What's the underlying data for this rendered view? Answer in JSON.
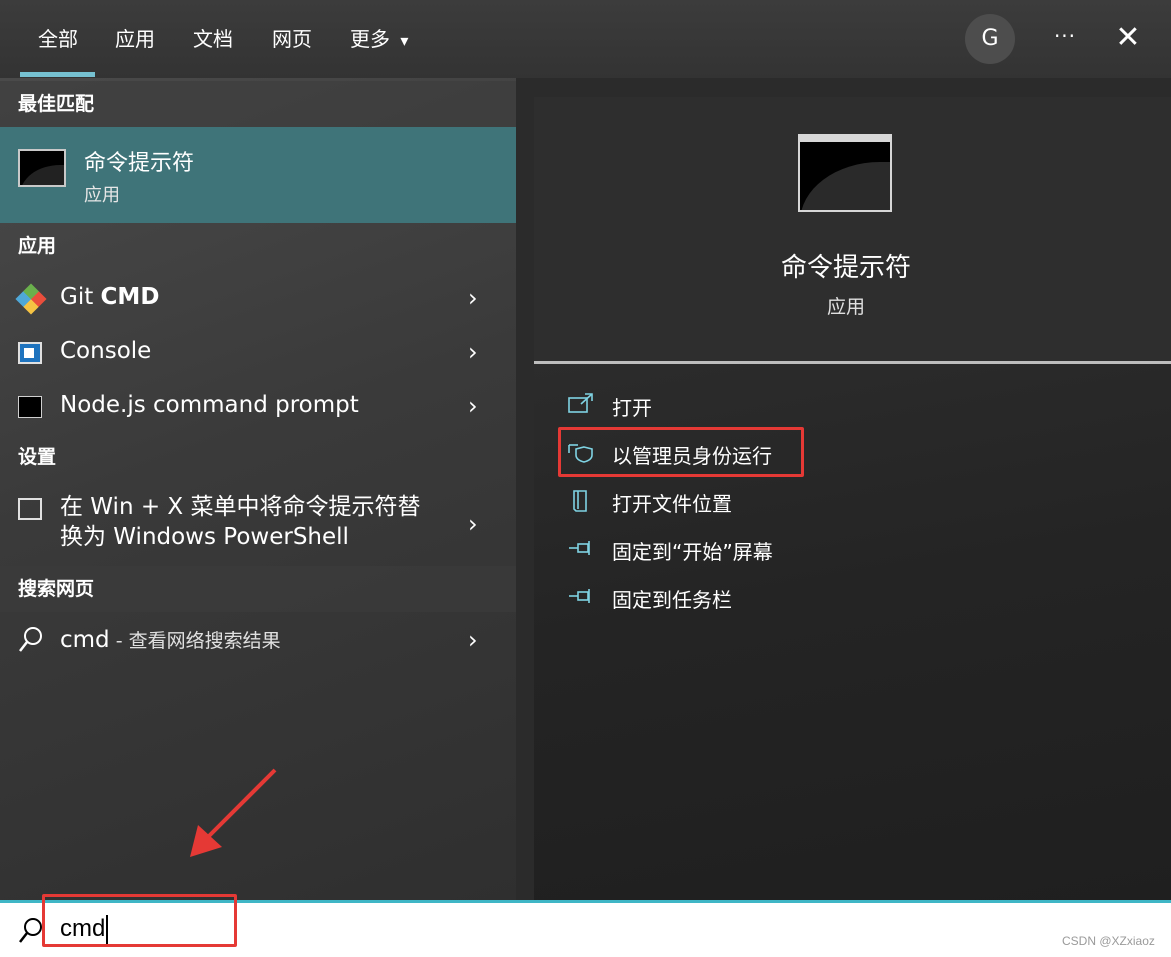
{
  "tabs": {
    "all": "全部",
    "apps": "应用",
    "docs": "文档",
    "web": "网页",
    "more": "更多",
    "more_arrow": "▾"
  },
  "topbar": {
    "avatar": "G",
    "more_menu": "···",
    "close": "✕"
  },
  "left": {
    "best_match_header": "最佳匹配",
    "best_match": {
      "title": "命令提示符",
      "subtitle": "应用"
    },
    "apps_header": "应用",
    "apps": [
      {
        "label_prefix": "Git ",
        "label_bold": "CMD",
        "icon": "git-icon"
      },
      {
        "label": "Console",
        "icon": "console-icon"
      },
      {
        "label": "Node.js command prompt",
        "icon": "terminal-icon"
      }
    ],
    "settings_header": "设置",
    "settings_item": {
      "line1": "在 Win + X 菜单中将命令提示符替",
      "line2": "换为 Windows PowerShell"
    },
    "web_header": "搜索网页",
    "web_item": {
      "query": "cmd",
      "suffix": " - 查看网络搜索结果"
    },
    "chevron": "›"
  },
  "right": {
    "title": "命令提示符",
    "subtitle": "应用",
    "actions": [
      {
        "label": "打开",
        "icon": "open-icon"
      },
      {
        "label": "以管理员身份运行",
        "icon": "shield-icon"
      },
      {
        "label": "打开文件位置",
        "icon": "folder-icon"
      },
      {
        "label": "固定到“开始”屏幕",
        "icon": "pin-icon"
      },
      {
        "label": "固定到任务栏",
        "icon": "pin-icon"
      }
    ]
  },
  "search": {
    "value": "cmd"
  },
  "watermark": "CSDN @XZxiaoz",
  "colors": {
    "accent": "#76c1d1",
    "selected_bg": "#3f7479",
    "highlight": "#e53935",
    "search_border": "#3fb6c6"
  }
}
